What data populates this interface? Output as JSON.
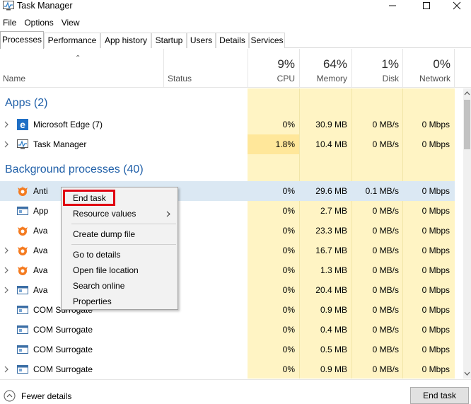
{
  "window": {
    "title": "Task Manager"
  },
  "menu": [
    "File",
    "Options",
    "View"
  ],
  "tabs": [
    "Processes",
    "Performance",
    "App history",
    "Startup",
    "Users",
    "Details",
    "Services"
  ],
  "columns": {
    "name": "Name",
    "status": "Status",
    "cpu": {
      "pct": "9%",
      "label": "CPU"
    },
    "memory": {
      "pct": "64%",
      "label": "Memory"
    },
    "disk": {
      "pct": "1%",
      "label": "Disk"
    },
    "network": {
      "pct": "0%",
      "label": "Network"
    }
  },
  "groups": {
    "apps": "Apps (2)",
    "background": "Background processes (40)"
  },
  "apps": [
    {
      "name": "Microsoft Edge (7)",
      "icon": "edge-icon",
      "cpu": "0%",
      "memory": "30.9 MB",
      "disk": "0 MB/s",
      "network": "0 Mbps"
    },
    {
      "name": "Task Manager",
      "icon": "task-manager-icon",
      "cpu": "1.8%",
      "memory": "10.4 MB",
      "disk": "0 MB/s",
      "network": "0 Mbps"
    }
  ],
  "background": [
    {
      "name": "Anti",
      "icon": "avast-icon",
      "cpu": "0%",
      "memory": "29.6 MB",
      "disk": "0.1 MB/s",
      "network": "0 Mbps",
      "selected": true
    },
    {
      "name": "App",
      "icon": "app-window-icon",
      "cpu": "0%",
      "memory": "2.7 MB",
      "disk": "0 MB/s",
      "network": "0 Mbps"
    },
    {
      "name": "Ava",
      "icon": "avast-icon",
      "cpu": "0%",
      "memory": "23.3 MB",
      "disk": "0 MB/s",
      "network": "0 Mbps"
    },
    {
      "name": "Ava",
      "icon": "avast-icon",
      "cpu": "0%",
      "memory": "16.7 MB",
      "disk": "0 MB/s",
      "network": "0 Mbps"
    },
    {
      "name": "Ava",
      "icon": "avast-icon",
      "cpu": "0%",
      "memory": "1.3 MB",
      "disk": "0 MB/s",
      "network": "0 Mbps"
    },
    {
      "name": "Ava",
      "icon": "app-window-icon",
      "cpu": "0%",
      "memory": "20.4 MB",
      "disk": "0 MB/s",
      "network": "0 Mbps"
    },
    {
      "name": "COM Surrogate",
      "icon": "app-window-icon",
      "cpu": "0%",
      "memory": "0.9 MB",
      "disk": "0 MB/s",
      "network": "0 Mbps"
    },
    {
      "name": "COM Surrogate",
      "icon": "app-window-icon",
      "cpu": "0%",
      "memory": "0.4 MB",
      "disk": "0 MB/s",
      "network": "0 Mbps"
    },
    {
      "name": "COM Surrogate",
      "icon": "app-window-icon",
      "cpu": "0%",
      "memory": "0.5 MB",
      "disk": "0 MB/s",
      "network": "0 Mbps"
    },
    {
      "name": "COM Surrogate",
      "icon": "app-window-icon",
      "cpu": "0%",
      "memory": "0.9 MB",
      "disk": "0 MB/s",
      "network": "0 Mbps"
    }
  ],
  "context_menu": {
    "end_task": "End task",
    "resource_values": "Resource values",
    "create_dump": "Create dump file",
    "go_to_details": "Go to details",
    "open_file_location": "Open file location",
    "search_online": "Search online",
    "properties": "Properties"
  },
  "footer": {
    "fewer_details": "Fewer details",
    "end_task": "End task"
  },
  "colors": {
    "heatmap": "#fff4c4",
    "selected_row": "#dbe8f3",
    "group_heading": "#1f5fa8",
    "highlight_box": "#e00010"
  }
}
